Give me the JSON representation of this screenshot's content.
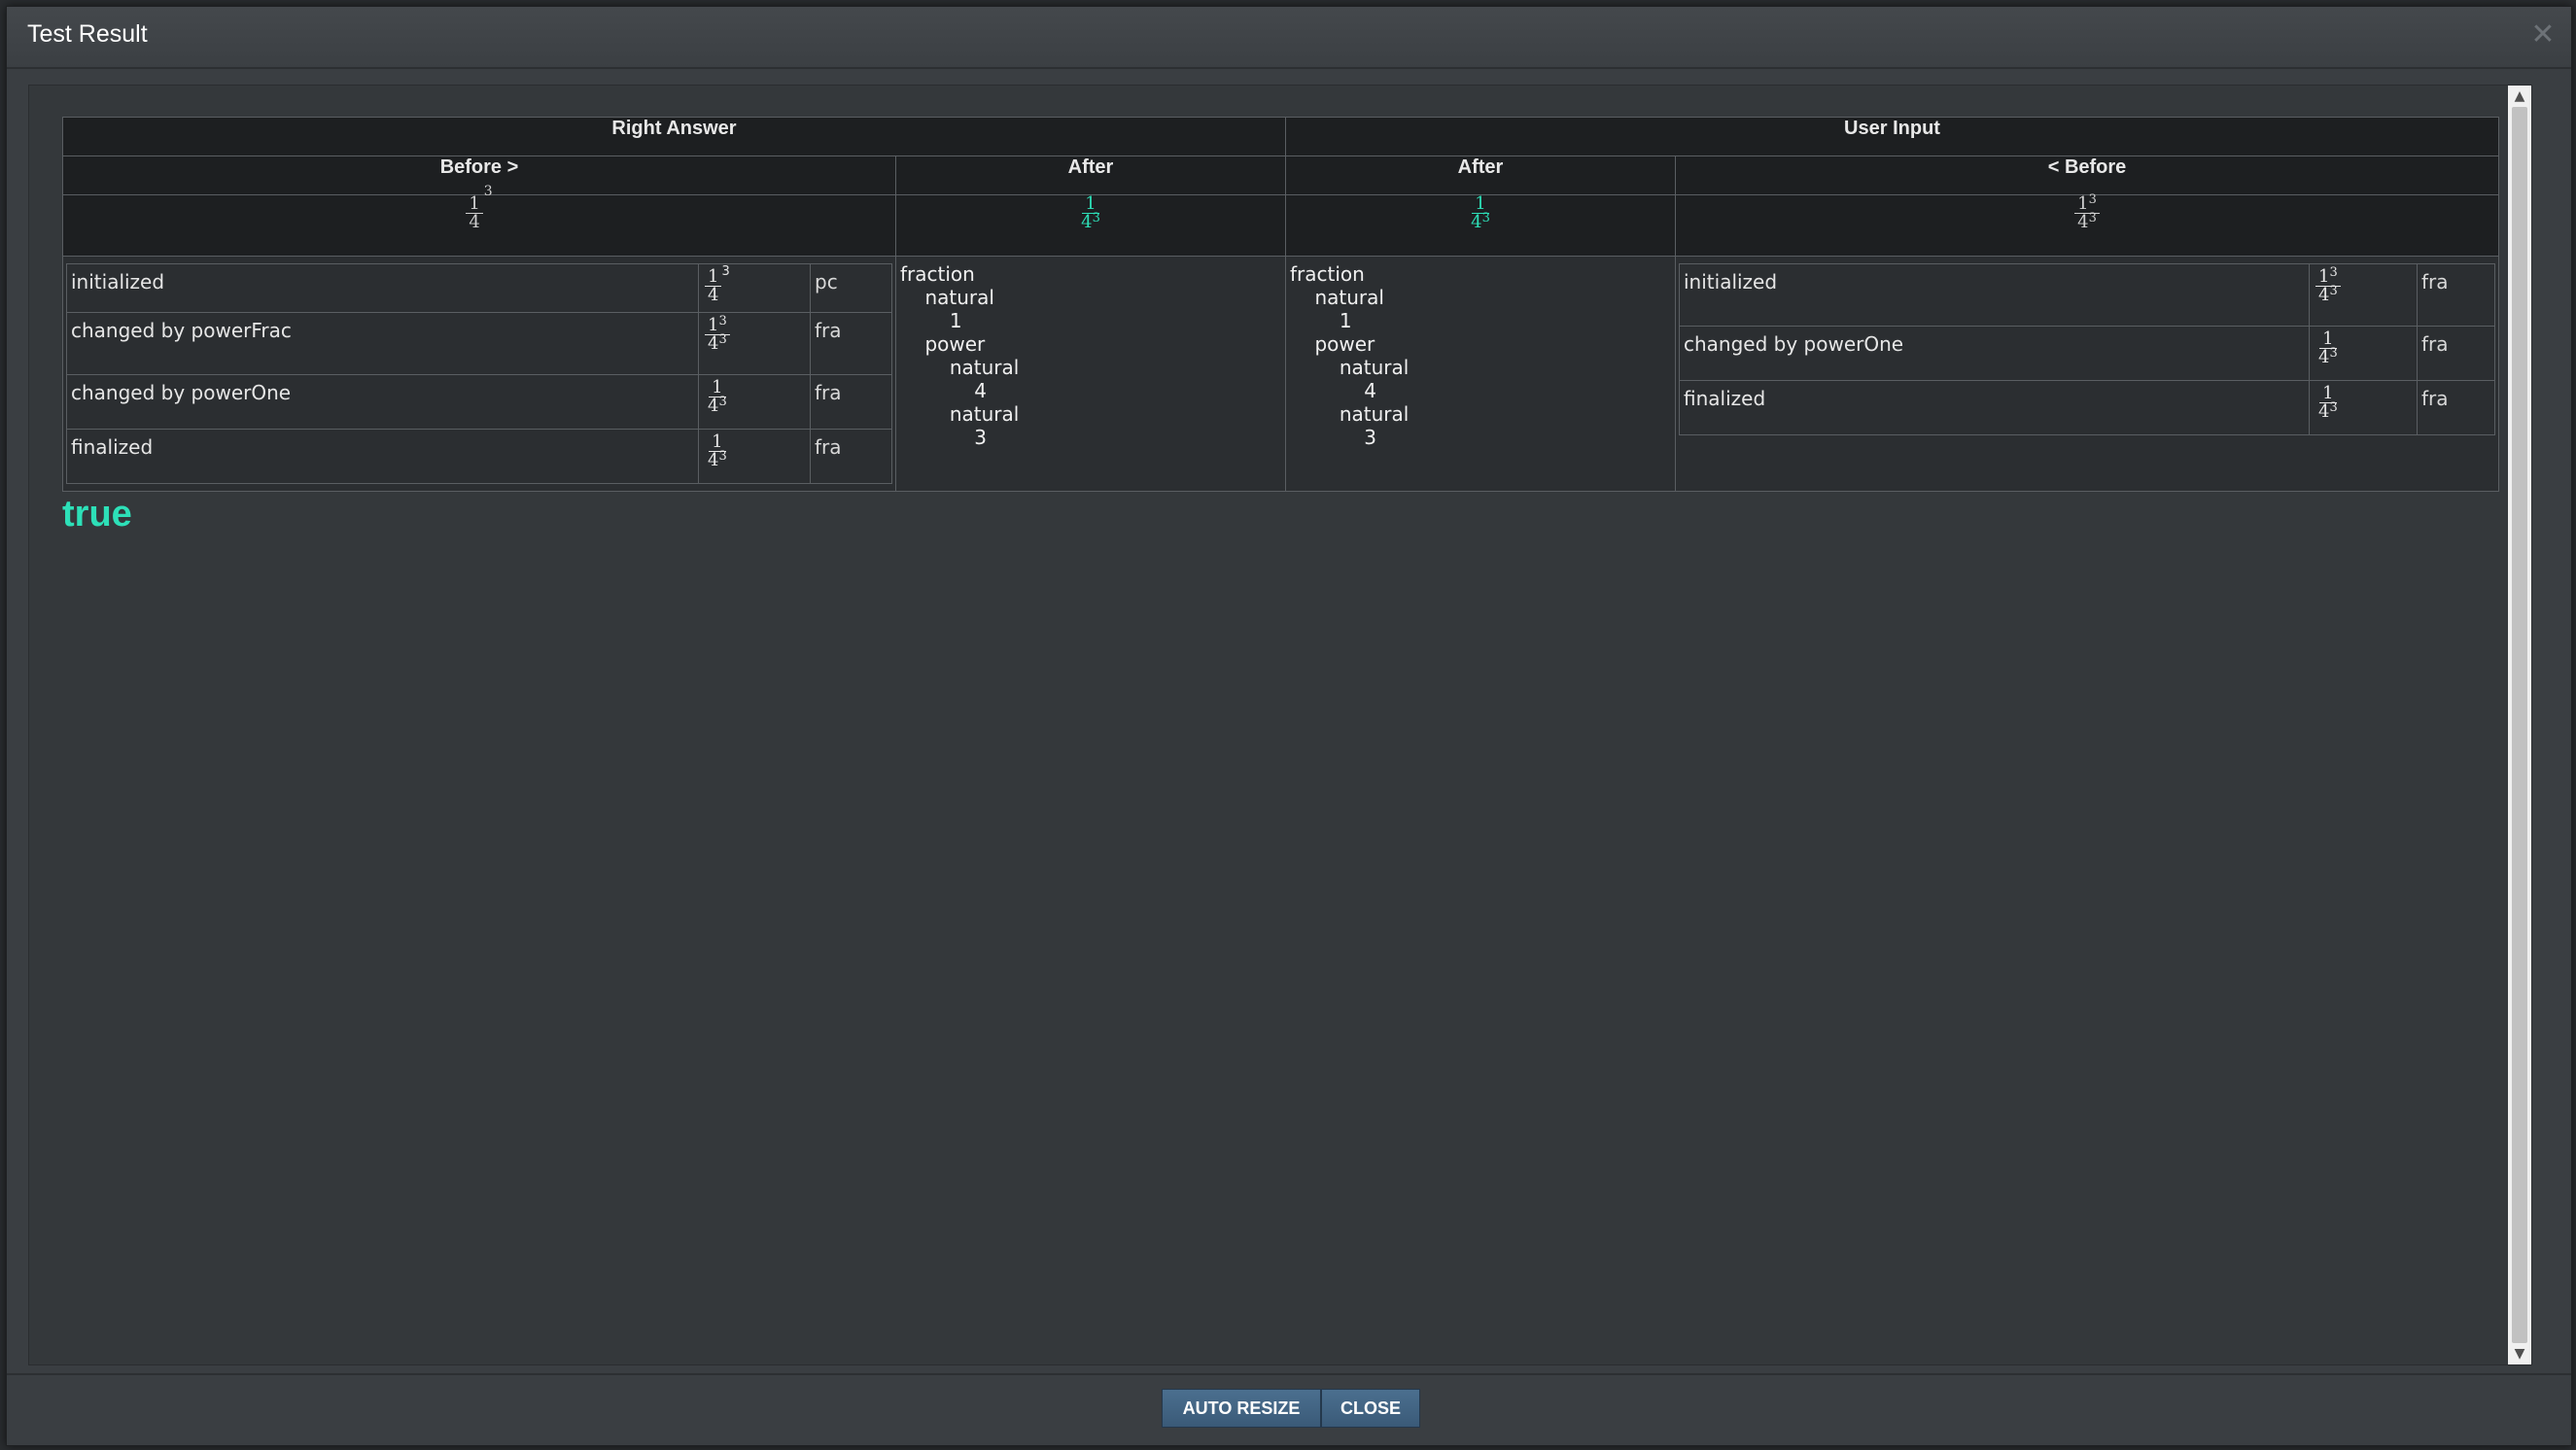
{
  "window": {
    "title": "Test Result",
    "close_icon": "close-icon"
  },
  "table": {
    "right_answer_label": "Right Answer",
    "user_input_label": "User Input",
    "before_right_label": "Before >",
    "after_right_label": "After",
    "after_user_label": "After",
    "before_user_label": "< Before"
  },
  "math": {
    "one": "1",
    "four": "4",
    "three": "3"
  },
  "right_steps": [
    {
      "label": "initialized",
      "extra": "pc"
    },
    {
      "label": "changed by powerFrac",
      "extra": "fra"
    },
    {
      "label": "changed by powerOne",
      "extra": "fra"
    },
    {
      "label": "finalized",
      "extra": "fra"
    }
  ],
  "user_steps": [
    {
      "label": "initialized",
      "extra": "fra"
    },
    {
      "label": "changed by powerOne",
      "extra": "fra"
    },
    {
      "label": "finalized",
      "extra": "fra"
    }
  ],
  "tree": {
    "lines": [
      "fraction",
      "natural",
      "1",
      "power",
      "natural",
      "4",
      "natural",
      "3"
    ]
  },
  "result": {
    "text": "true"
  },
  "footer": {
    "auto_resize_label": "AUTO RESIZE",
    "close_label": "CLOSE"
  },
  "colors": {
    "accent": "#2de0b8",
    "button": "#3f6382"
  }
}
